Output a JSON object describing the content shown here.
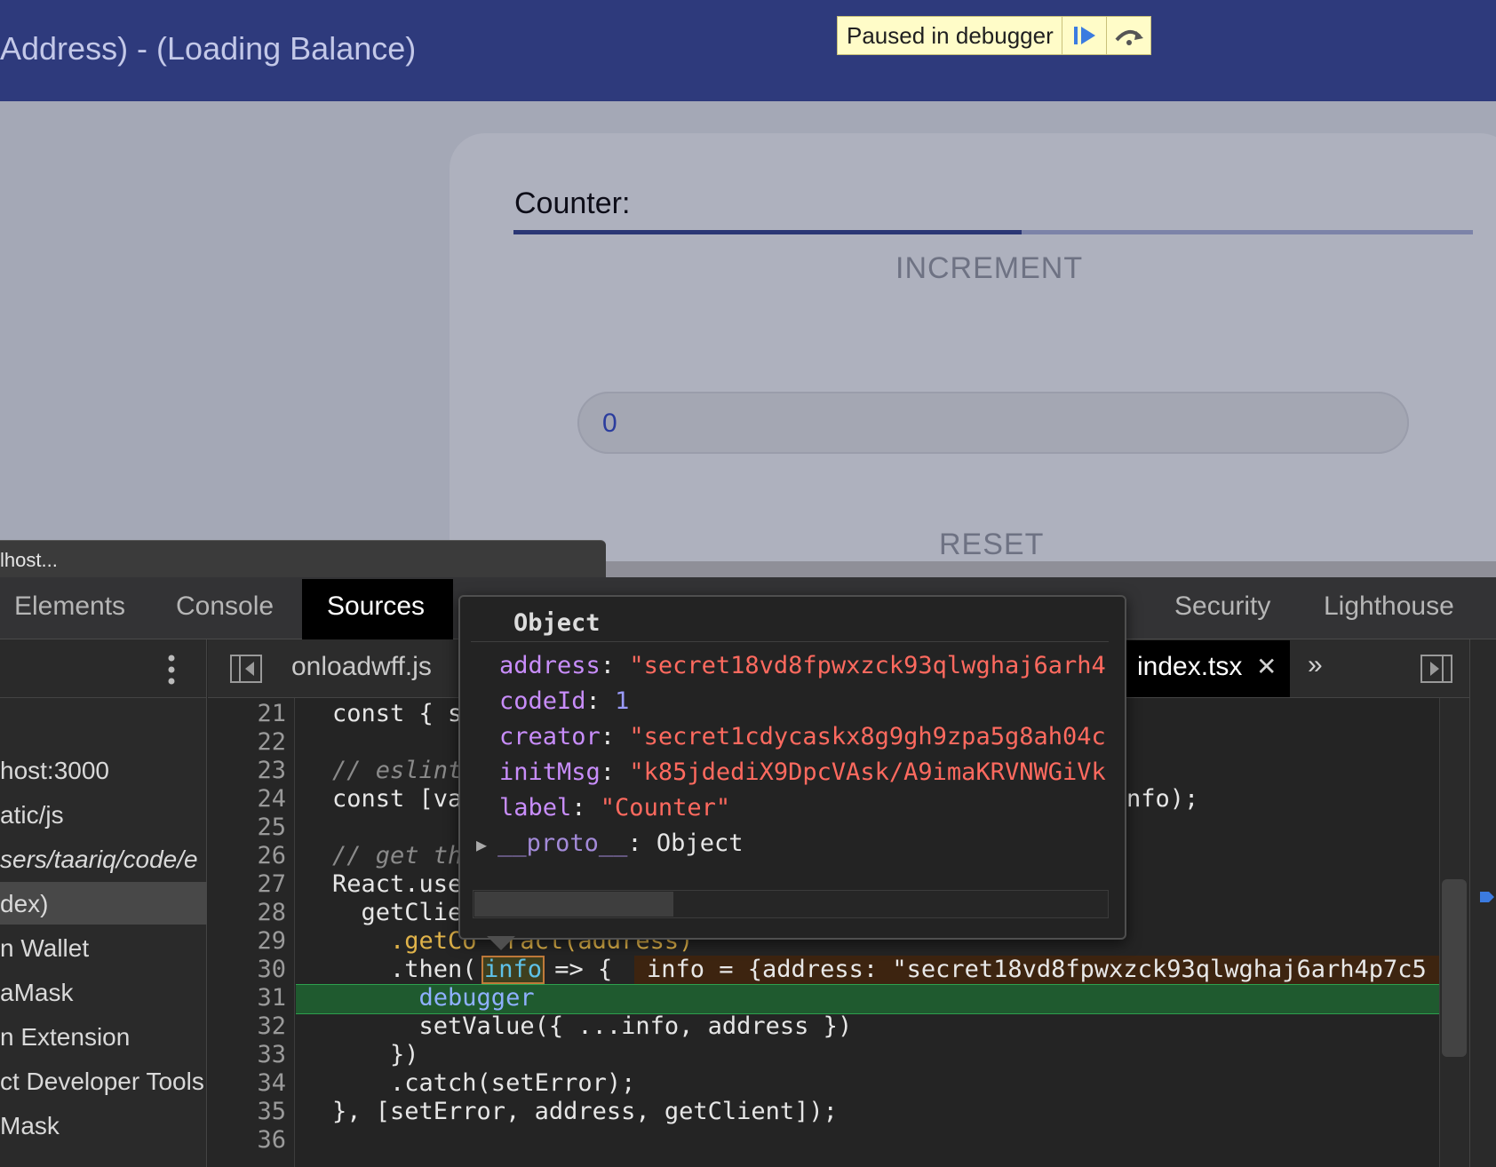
{
  "app": {
    "title": "Address) - (Loading Balance)"
  },
  "debugger_banner": {
    "text": "Paused in debugger"
  },
  "card": {
    "counter_label": "Counter:",
    "progress_fraction": 0.53,
    "increment_label": "INCREMENT",
    "counter_value": "0",
    "reset_label": "RESET"
  },
  "window_bar": {
    "host_text": "lhost..."
  },
  "devtools": {
    "tabs": [
      {
        "label": "Elements"
      },
      {
        "label": "Console"
      },
      {
        "label": "Sources",
        "active": true
      },
      {
        "label": "Security"
      },
      {
        "label": "Lighthouse"
      }
    ],
    "navigator": {
      "items": [
        {
          "label": "host:3000"
        },
        {
          "label": "atic/js"
        },
        {
          "label": "sers/taariq/code/e"
        },
        {
          "label": "dex)",
          "selected": true
        },
        {
          "label": "n Wallet"
        },
        {
          "label": "aMask"
        },
        {
          "label": "n Extension"
        },
        {
          "label": "ct Developer Tools"
        },
        {
          "label": "Mask"
        }
      ]
    },
    "file_tabs": [
      {
        "label": "onloadwff.js"
      },
      {
        "label": "index.tsx",
        "active": true
      }
    ],
    "more_tabs_glyph": "»",
    "code": {
      "line_numbers": [
        "21",
        "22",
        "23",
        "24",
        "25",
        "26",
        "27",
        "28",
        "29",
        "30",
        "31",
        "32",
        "33",
        "34",
        "35",
        "36"
      ],
      "lines": [
        "const { s",
        "",
        "// eslint",
        "const [va",
        "",
        "// get th",
        "React.use",
        "  getClie",
        "    .getCo  ract(address)",
        "    .then(",
        "      debugger",
        "      setValue({ ...info, address })",
        "    })",
        "    .catch(setError);",
        "}, [setError, address, getClient]);",
        ""
      ],
      "line24_tail": "nfo);",
      "line30_param": "info",
      "line30_arrow": " => {",
      "inline_value": "info = {address: \"secret18vd8fpwxzck93qlwghaj6arh4p7c5"
    },
    "popover": {
      "title": "Object",
      "properties": [
        {
          "key": "address",
          "value": "\"secret18vd8fpwxzck93qlwghaj6arh4",
          "type": "string"
        },
        {
          "key": "codeId",
          "value": "1",
          "type": "number"
        },
        {
          "key": "creator",
          "value": "\"secret1cdycaskx8g9gh9zpa5g8ah04c",
          "type": "string"
        },
        {
          "key": "initMsg",
          "value": "\"k85jdediX9DpcVAsk/A9imaKRVNWGiVk",
          "type": "string"
        },
        {
          "key": "label",
          "value": "\"Counter\"",
          "type": "string"
        }
      ],
      "proto": "__proto__",
      "proto_value": "Object"
    }
  },
  "colors": {
    "header_bg": "#2e3a7c",
    "banner_bg": "#fffcc8",
    "accent": "#2b3775",
    "string": "#ff6a5f",
    "key": "#c88dfa",
    "execution_line": "#1f5a2f"
  }
}
